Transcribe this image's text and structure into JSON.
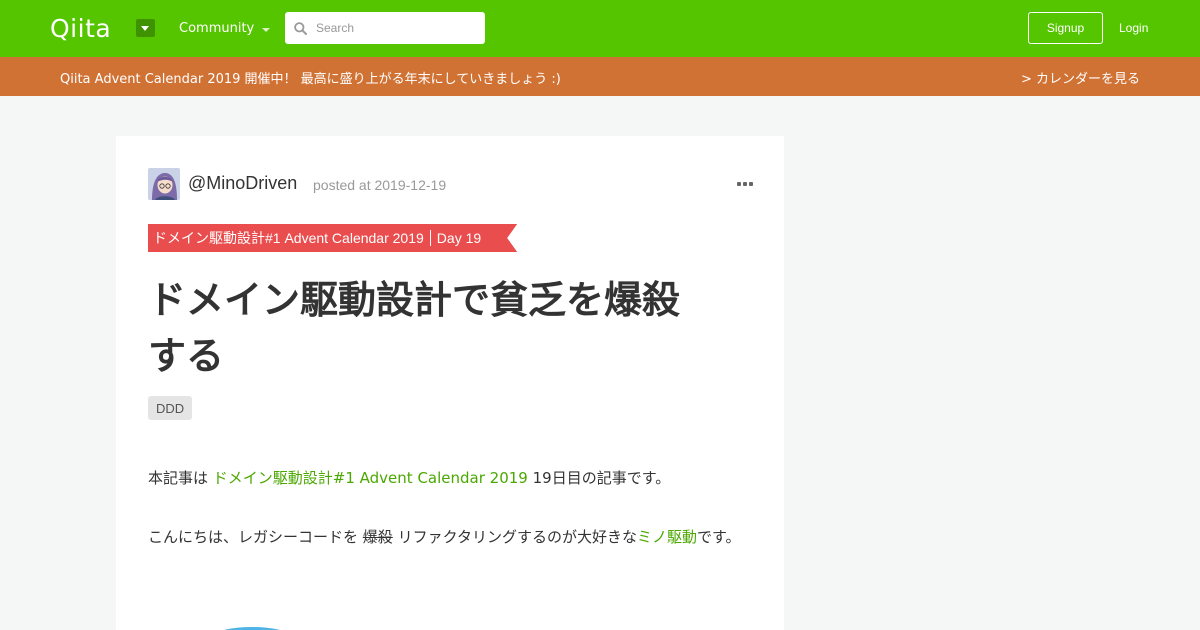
{
  "header": {
    "logo": "Qiita",
    "community_label": "Community",
    "search_placeholder": "Search",
    "signup_label": "Signup",
    "login_label": "Login"
  },
  "banner": {
    "text": "Qiita Advent Calendar 2019 開催中！ 最高に盛り上がる年末にしていきましょう :)",
    "link": "> カレンダーを見る"
  },
  "article": {
    "author": "@MinoDriven",
    "posted": "posted at 2019-12-19",
    "calendar": "ドメイン駆動設計#1 Advent Calendar 2019",
    "day": "Day 19",
    "title_line1": "ドメイン駆動設計で貧乏を爆殺",
    "title_line2": "する",
    "tag": "DDD",
    "p1_prefix": "本記事は ",
    "p1_link": "ドメイン駆動設計#1 Advent Calendar 2019",
    "p1_suffix": " 19日目の記事です。",
    "p2_prefix": "こんにちは、レガシーコードを ",
    "p2_strike": "爆殺",
    "p2_middle": " リファクタリングするのが大好きな",
    "p2_link": "ミノ駆動",
    "p2_suffix": "です。"
  },
  "colors": {
    "header_bg": "#55c500",
    "banner_bg": "#d17235",
    "ribbon_bg": "#e94d4d",
    "link": "#4ba800"
  }
}
